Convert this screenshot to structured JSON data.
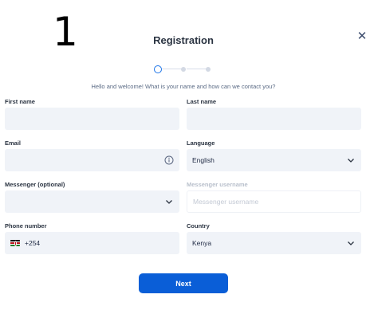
{
  "step_number": "1",
  "header": {
    "title": "Registration",
    "close_icon": "close-icon"
  },
  "stepper": {
    "current_step": 1,
    "total_steps": 3
  },
  "subtitle": "Hello and welcome! What is your name and how can we contact you?",
  "form": {
    "first_name": {
      "label": "First name",
      "value": ""
    },
    "last_name": {
      "label": "Last name",
      "value": ""
    },
    "email": {
      "label": "Email",
      "value": "",
      "icon": "info-icon"
    },
    "language": {
      "label": "Language",
      "value": "English",
      "icon": "chevron-down-icon"
    },
    "messenger": {
      "label": "Messenger (optional)",
      "value": "",
      "icon": "chevron-down-icon"
    },
    "messenger_username": {
      "label": "Messenger username",
      "placeholder": "Messenger username",
      "disabled": true
    },
    "phone": {
      "label": "Phone number",
      "flag": "kenya-flag-icon",
      "value": "+254"
    },
    "country": {
      "label": "Country",
      "value": "Kenya",
      "icon": "chevron-down-icon"
    }
  },
  "actions": {
    "next_label": "Next"
  },
  "colors": {
    "accent": "#0a5ed7",
    "field_bg": "#f0f3f8",
    "active_step": "#1a73e8"
  }
}
